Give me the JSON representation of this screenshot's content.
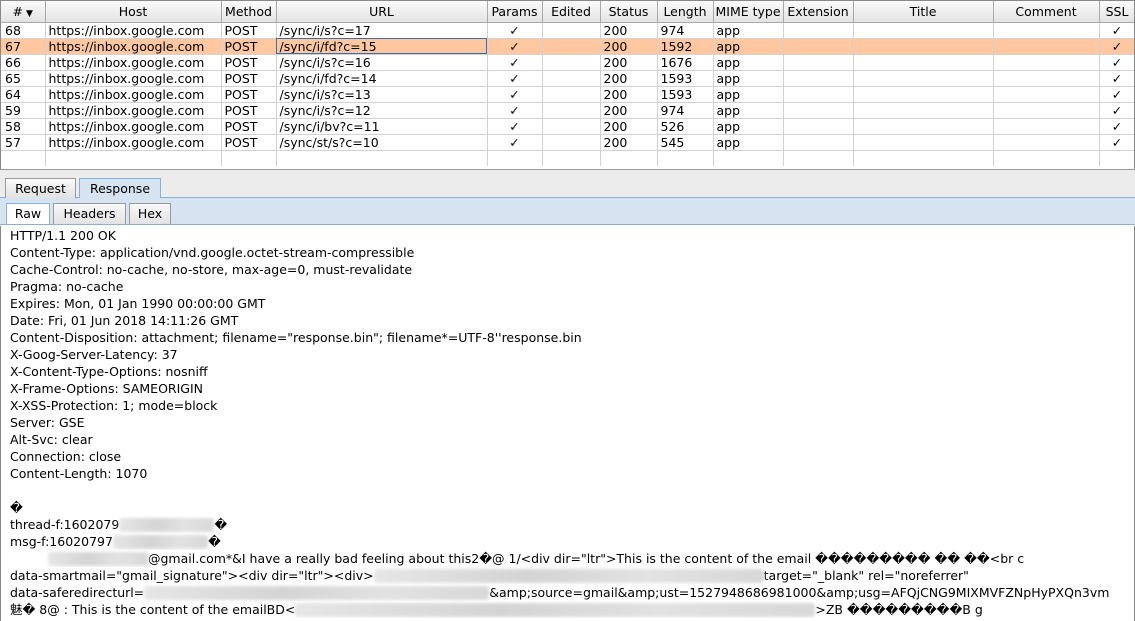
{
  "history": {
    "columns": [
      "#",
      "Host",
      "Method",
      "URL",
      "Params",
      "Edited",
      "Status",
      "Length",
      "MIME type",
      "Extension",
      "Title",
      "Comment",
      "SSL"
    ],
    "rows": [
      {
        "num": "68",
        "host": "https://inbox.google.com",
        "method": "POST",
        "url": "/sync/i/s?c=17",
        "params": "✓",
        "edited": "",
        "status": "200",
        "length": "974",
        "mime": "app",
        "ext": "",
        "title": "",
        "comment": "",
        "ssl": "✓"
      },
      {
        "num": "67",
        "host": "https://inbox.google.com",
        "method": "POST",
        "url": "/sync/i/fd?c=15",
        "params": "✓",
        "edited": "",
        "status": "200",
        "length": "1592",
        "mime": "app",
        "ext": "",
        "title": "",
        "comment": "",
        "ssl": "✓"
      },
      {
        "num": "66",
        "host": "https://inbox.google.com",
        "method": "POST",
        "url": "/sync/i/s?c=16",
        "params": "✓",
        "edited": "",
        "status": "200",
        "length": "1676",
        "mime": "app",
        "ext": "",
        "title": "",
        "comment": "",
        "ssl": "✓"
      },
      {
        "num": "65",
        "host": "https://inbox.google.com",
        "method": "POST",
        "url": "/sync/i/fd?c=14",
        "params": "✓",
        "edited": "",
        "status": "200",
        "length": "1593",
        "mime": "app",
        "ext": "",
        "title": "",
        "comment": "",
        "ssl": "✓"
      },
      {
        "num": "64",
        "host": "https://inbox.google.com",
        "method": "POST",
        "url": "/sync/i/s?c=13",
        "params": "✓",
        "edited": "",
        "status": "200",
        "length": "1593",
        "mime": "app",
        "ext": "",
        "title": "",
        "comment": "",
        "ssl": "✓"
      },
      {
        "num": "59",
        "host": "https://inbox.google.com",
        "method": "POST",
        "url": "/sync/i/s?c=12",
        "params": "✓",
        "edited": "",
        "status": "200",
        "length": "974",
        "mime": "app",
        "ext": "",
        "title": "",
        "comment": "",
        "ssl": "✓"
      },
      {
        "num": "58",
        "host": "https://inbox.google.com",
        "method": "POST",
        "url": "/sync/i/bv?c=11",
        "params": "✓",
        "edited": "",
        "status": "200",
        "length": "526",
        "mime": "app",
        "ext": "",
        "title": "",
        "comment": "",
        "ssl": "✓"
      },
      {
        "num": "57",
        "host": "https://inbox.google.com",
        "method": "POST",
        "url": "/sync/st/s?c=10",
        "params": "✓",
        "edited": "",
        "status": "200",
        "length": "545",
        "mime": "app",
        "ext": "",
        "title": "",
        "comment": "",
        "ssl": "✓"
      }
    ],
    "selected_row": "67",
    "selected_color": "#ffc8a0"
  },
  "tabs_main": {
    "request": "Request",
    "response": "Response",
    "active": "response"
  },
  "tabs_view": {
    "raw": "Raw",
    "headers": "Headers",
    "hex": "Hex",
    "active": "raw"
  },
  "response": {
    "lines": [
      "HTTP/1.1 200 OK",
      "Content-Type: application/vnd.google.octet-stream-compressible",
      "Cache-Control: no-cache, no-store, max-age=0, must-revalidate",
      "Pragma: no-cache",
      "Expires: Mon, 01 Jan 1990 00:00:00 GMT",
      "Date: Fri, 01 Jun 2018 14:11:26 GMT",
      "Content-Disposition: attachment; filename=\"response.bin\"; filename*=UTF-8''response.bin",
      "X-Goog-Server-Latency: 37",
      "X-Content-Type-Options: nosniff",
      "X-Frame-Options: SAMEORIGIN",
      "X-XSS-Protection: 1; mode=block",
      "Server: GSE",
      "Alt-Svc: clear",
      "Connection: close",
      "Content-Length: 1070",
      "",
      "  �"
    ],
    "body": {
      "l1_a": "thread-f:1602079",
      "l1_b": "�",
      "l2_a": "msg-f:16020797",
      "l2_b": "�",
      "l3_a": "",
      "l3_b": "@gmail.com*&I have a really bad feeling about this2�@  1/<div dir=\"ltr\">This is the content of the email ��������� �� ��<br c",
      "l4_a": "data-smartmail=\"gmail_signature\"><div dir=\"ltr\"><div>",
      "l4_b": "target=\"_blank\" rel=\"noreferrer\"",
      "l5_a": "data-saferedirecturl=",
      "l5_b": "&amp;source=gmail&amp;ust=1527948686981000&amp;usg=AFQjCNG9MIXMVFZNpHyPXQn3vm",
      "l6_a": "魅�  8@  : This is the content of the emailBD<",
      "l6_b": ">ZB       ���������B     g"
    }
  }
}
